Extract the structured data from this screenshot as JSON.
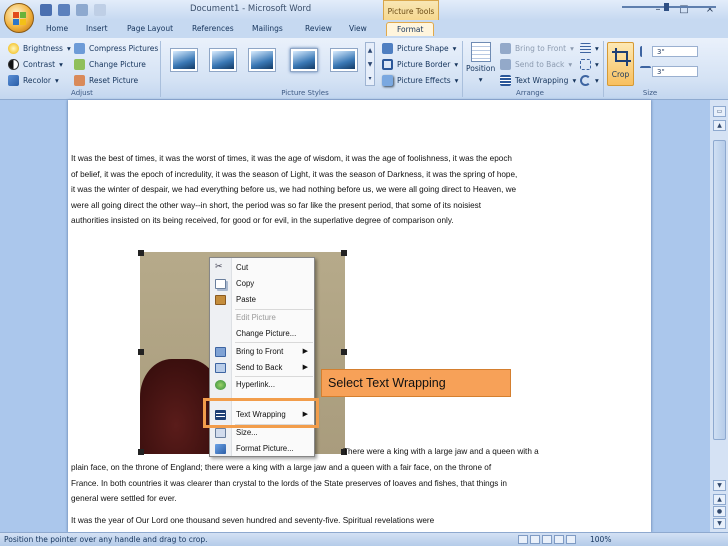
{
  "window": {
    "title": "Document1 - Microsoft Word",
    "contextual_tab_group": "Picture Tools"
  },
  "tabs": [
    {
      "label": "Home"
    },
    {
      "label": "Insert"
    },
    {
      "label": "Page Layout"
    },
    {
      "label": "References"
    },
    {
      "label": "Mailings"
    },
    {
      "label": "Review"
    },
    {
      "label": "View"
    },
    {
      "label": "Format",
      "active": true
    }
  ],
  "ribbon": {
    "adjust": {
      "label": "Adjust",
      "brightness": "Brightness",
      "contrast": "Contrast",
      "recolor": "Recolor",
      "compress": "Compress Pictures",
      "change": "Change Picture",
      "reset": "Reset Picture"
    },
    "picture_styles": {
      "label": "Picture Styles",
      "shape": "Picture Shape",
      "border": "Picture Border",
      "effects": "Picture Effects"
    },
    "arrange": {
      "label": "Arrange",
      "position": "Position",
      "bring_front": "Bring to Front",
      "send_back": "Send to Back",
      "text_wrapping": "Text Wrapping"
    },
    "size": {
      "label": "Size",
      "crop": "Crop",
      "height": "3\"",
      "width": "3\""
    }
  },
  "document": {
    "paragraph1": "It was the best of times, it was the worst of times, it was the age of wisdom, it was the age of foolishness, it was the epoch of belief, it was the epoch of incredulity, it was the season of Light, it was the season of Darkness, it was the spring of hope, it was the winter of despair, we had everything before us, we had nothing before us, we were all going direct to Heaven, we were all going direct the other way--in short, the period was so far like the present period, that some of its noisiest authorities insisted on its being received, for good or for evil, in the superlative degree of comparison only.",
    "paragraph2_first": "There were a king with a large jaw and a queen with a",
    "paragraph2_rest": "plain face, on the throne of England; there were a king with a large jaw and a queen with a fair face, on the throne of France. In both countries it was clearer than crystal to the lords of the State preserves of loaves and fishes, that things in general were settled for ever.",
    "paragraph3": "It was the year of Our Lord one thousand seven hundred and seventy-five. Spiritual revelations were"
  },
  "context_menu": {
    "items": [
      {
        "label": "Cut",
        "disabled": false,
        "submenu": false,
        "icon": "scissors-icon"
      },
      {
        "label": "Copy",
        "disabled": false,
        "submenu": false,
        "icon": "copy-icon"
      },
      {
        "label": "Paste",
        "disabled": false,
        "submenu": false,
        "icon": "paste-icon"
      },
      {
        "label": "Edit Picture",
        "disabled": true,
        "submenu": false,
        "icon": ""
      },
      {
        "label": "Change Picture...",
        "disabled": false,
        "submenu": false,
        "icon": "change-picture-icon"
      },
      {
        "label": "Bring to Front",
        "disabled": false,
        "submenu": true,
        "icon": "bring-front-icon"
      },
      {
        "label": "Send to Back",
        "disabled": false,
        "submenu": true,
        "icon": "send-back-icon"
      },
      {
        "label": "Hyperlink...",
        "disabled": false,
        "submenu": false,
        "icon": "hyperlink-icon"
      },
      {
        "label": "Text Wrapping",
        "disabled": false,
        "submenu": true,
        "icon": "text-wrapping-icon"
      },
      {
        "label": "Size...",
        "disabled": false,
        "submenu": false,
        "icon": "size-icon"
      },
      {
        "label": "Format Picture...",
        "disabled": false,
        "submenu": false,
        "icon": "format-picture-icon"
      }
    ]
  },
  "callout": {
    "text": "Select Text Wrapping"
  },
  "statusbar": {
    "message": "Position the pointer over any handle and drag to crop.",
    "zoom": "100%"
  },
  "colors": {
    "accent": "#f7a158",
    "ribbon_bg": "#dbe6f5",
    "active_tab": "#fff5dd"
  }
}
